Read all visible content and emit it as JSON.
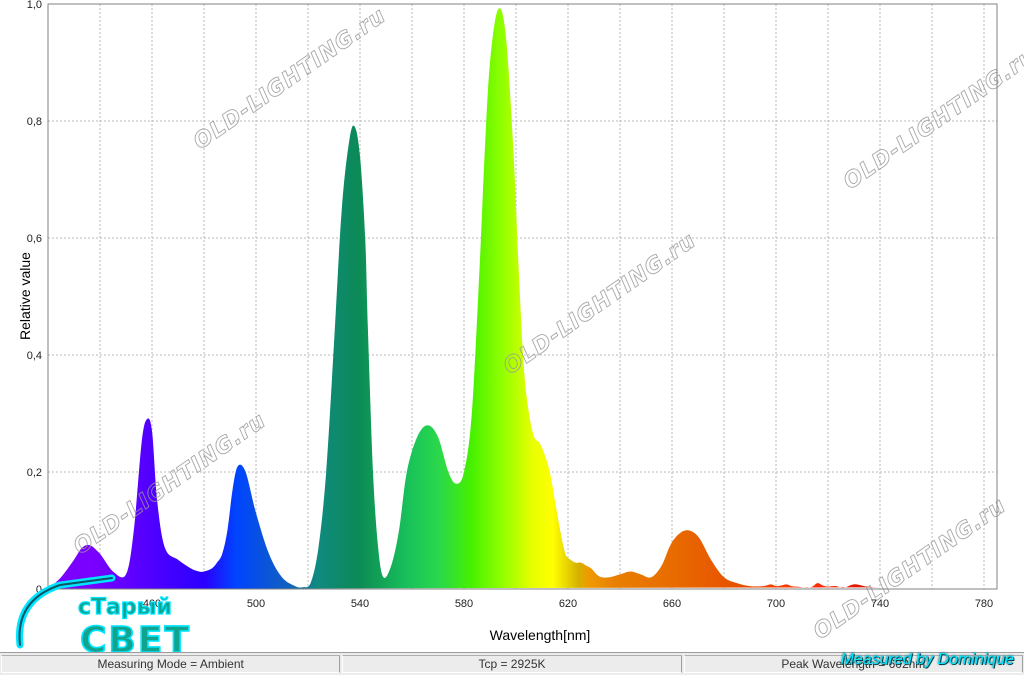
{
  "chart_data": {
    "type": "area",
    "xlabel": "Wavelength[nm]",
    "ylabel": "Relative value",
    "xlim": [
      420,
      785
    ],
    "ylim": [
      0,
      1.0
    ],
    "xticks": [
      "460",
      "500",
      "540",
      "580",
      "620",
      "660",
      "700",
      "740",
      "780"
    ],
    "xtick_values": [
      460,
      500,
      540,
      580,
      620,
      660,
      700,
      740,
      780
    ],
    "yticks": [
      "0",
      "0,2",
      "0,4",
      "0,6",
      "0,8",
      "1,0"
    ],
    "ytick_values": [
      0,
      0.2,
      0.4,
      0.6,
      0.8,
      1.0
    ],
    "grid": true,
    "x": [
      420,
      425,
      430,
      433,
      436,
      440,
      445,
      450,
      453,
      456,
      458,
      460,
      462,
      465,
      470,
      475,
      478,
      480,
      483,
      485,
      487,
      489,
      491,
      493,
      496,
      500,
      505,
      510,
      515,
      518,
      521,
      524,
      527,
      530,
      533,
      536,
      538,
      540,
      542,
      543,
      545,
      547,
      549,
      552,
      555,
      558,
      562,
      566,
      570,
      574,
      577,
      580,
      583,
      586,
      588,
      590,
      593,
      596,
      599,
      601,
      603,
      605,
      607,
      609,
      611,
      613,
      615,
      617,
      619,
      621,
      623,
      625,
      627,
      629,
      631,
      633,
      636,
      640,
      644,
      648,
      652,
      656,
      660,
      665,
      670,
      675,
      680,
      685,
      690,
      695,
      698,
      700,
      702,
      704,
      706,
      708,
      710,
      712,
      714,
      716,
      718,
      720,
      723,
      726,
      730,
      735,
      740,
      745,
      750,
      755,
      760,
      765,
      770,
      775,
      780,
      785
    ],
    "values": [
      0.0,
      0.02,
      0.05,
      0.07,
      0.075,
      0.06,
      0.03,
      0.025,
      0.1,
      0.25,
      0.29,
      0.27,
      0.15,
      0.07,
      0.05,
      0.035,
      0.03,
      0.03,
      0.035,
      0.045,
      0.06,
      0.1,
      0.17,
      0.21,
      0.2,
      0.13,
      0.06,
      0.02,
      0.005,
      0.003,
      0.01,
      0.07,
      0.2,
      0.42,
      0.65,
      0.77,
      0.79,
      0.74,
      0.6,
      0.45,
      0.2,
      0.07,
      0.02,
      0.04,
      0.1,
      0.2,
      0.26,
      0.28,
      0.26,
      0.2,
      0.18,
      0.2,
      0.3,
      0.55,
      0.75,
      0.9,
      0.99,
      0.95,
      0.75,
      0.55,
      0.38,
      0.3,
      0.26,
      0.25,
      0.23,
      0.2,
      0.15,
      0.1,
      0.06,
      0.05,
      0.045,
      0.045,
      0.04,
      0.035,
      0.025,
      0.02,
      0.02,
      0.025,
      0.03,
      0.025,
      0.02,
      0.04,
      0.08,
      0.1,
      0.09,
      0.05,
      0.02,
      0.01,
      0.005,
      0.005,
      0.008,
      0.005,
      0.006,
      0.008,
      0.005,
      0.004,
      0.003,
      0.002,
      0.004,
      0.01,
      0.006,
      0.004,
      0.005,
      0.002,
      0.008,
      0.004,
      0.003,
      0.004
    ]
  },
  "watermark_text": "OLD-LIGHTING.ru",
  "status": {
    "measuring_mode": "Measuring Mode = Ambient",
    "tcp": "Tcp = 2925K",
    "peak": "Peak Wavelength = 602nm"
  },
  "credit": "Measured by Dominique",
  "logo": {
    "line1": "сТарый",
    "line2": "СВЕТ"
  },
  "colors": {
    "grid": "#b8b8b8",
    "plot_border": "#808080",
    "logo_cyan": "#00e5ff",
    "logo_bg": "#10b39a"
  }
}
